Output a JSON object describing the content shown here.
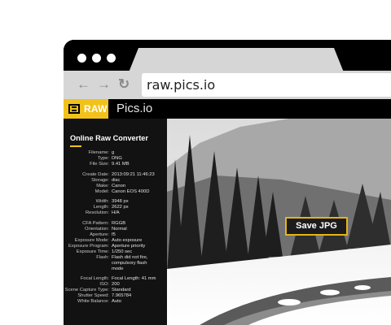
{
  "browser": {
    "url": "raw.pics.io",
    "nav_icons": [
      "back-arrow-icon",
      "forward-arrow-icon",
      "reload-icon"
    ]
  },
  "app": {
    "logo_text": "RAW",
    "brand": "Pics.io",
    "accent_color": "#f2c21b"
  },
  "panel": {
    "title": "Online Raw Converter",
    "groups": [
      [
        {
          "k": "Filename:",
          "v": "g"
        },
        {
          "k": "Type:",
          "v": "DNG"
        },
        {
          "k": "File Size:",
          "v": "9.41 MB"
        }
      ],
      [
        {
          "k": "Create Date:",
          "v": "2013:09:21 11:46:23"
        },
        {
          "k": "Storage:",
          "v": "disc"
        },
        {
          "k": "Make:",
          "v": "Canon"
        },
        {
          "k": "Model:",
          "v": "Canon EOS 400D"
        }
      ],
      [
        {
          "k": "Width:",
          "v": "3948 px"
        },
        {
          "k": "Length:",
          "v": "2622 px"
        },
        {
          "k": "Resolution:",
          "v": "H/A"
        }
      ],
      [
        {
          "k": "CFA Pattern:",
          "v": "RGGB"
        },
        {
          "k": "Orientation:",
          "v": "Normal"
        },
        {
          "k": "Aperture:",
          "v": "f5"
        },
        {
          "k": "Exposure Mode:",
          "v": "Auto exposure"
        },
        {
          "k": "Exposure Program:",
          "v": "Aperture priority"
        },
        {
          "k": "Exposure Time:",
          "v": "1/250 sec"
        },
        {
          "k": "Flash:",
          "v": "Flash did not fire,"
        },
        {
          "k": "",
          "v": "compulsory flash"
        },
        {
          "k": "",
          "v": "mode"
        }
      ],
      [
        {
          "k": "Focal Length:",
          "v": "Focal Length: 41 mm"
        },
        {
          "k": "ISO:",
          "v": "200"
        },
        {
          "k": "Scene Capture Type:",
          "v": "Standard"
        },
        {
          "k": "Shutter Speed:",
          "v": "7.965784"
        },
        {
          "k": "White Balance:",
          "v": "Auto"
        }
      ]
    ]
  },
  "actions": {
    "save_label": "Save JPG"
  }
}
